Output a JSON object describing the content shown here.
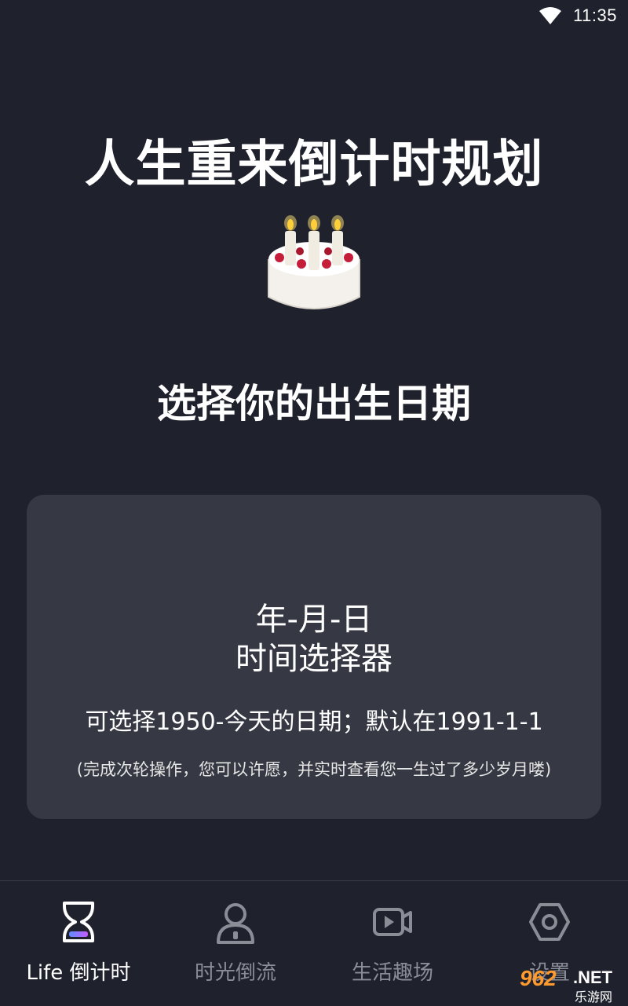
{
  "status_bar": {
    "time": "11:35",
    "wifi_icon": "wifi-icon"
  },
  "header": {
    "title": "人生重来倒计时规划",
    "emoji": "birthday-cake-icon"
  },
  "subtitle": "选择你的出生日期",
  "picker_card": {
    "line1": "年-月-日",
    "line2": "时间选择器",
    "hint": "可选择1950-今天的日期；默认在1991-1-1",
    "note": "(完成次轮操作，您可以许愿，并实时查看您一生过了多少岁月喽)"
  },
  "tabs": [
    {
      "label": "Life 倒计时",
      "icon": "hourglass-icon",
      "active": true
    },
    {
      "label": "时光倒流",
      "icon": "person-icon",
      "active": false
    },
    {
      "label": "生活趣场",
      "icon": "video-icon",
      "active": false
    },
    {
      "label": "设置",
      "icon": "settings-icon",
      "active": false
    }
  ],
  "watermark": {
    "brand": "962",
    "domain": ".NET",
    "text": "乐游网"
  },
  "colors": {
    "background": "#1f222d",
    "card": "#363943",
    "inactive": "#8a8d96",
    "accent_gradient": [
      "#5b8cff",
      "#c65bff"
    ]
  }
}
